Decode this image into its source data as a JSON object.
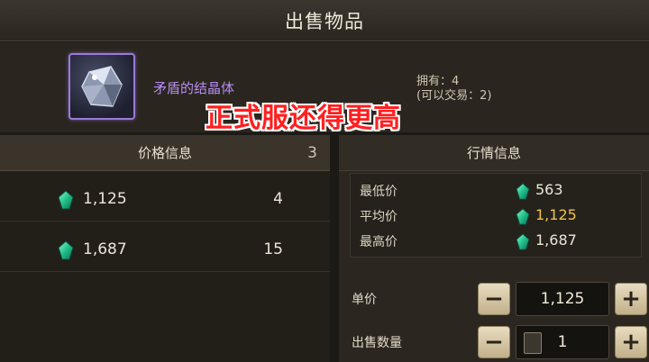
{
  "header": {
    "title": "出售物品"
  },
  "item": {
    "icon": "crystal-icon",
    "name": "矛盾的结晶体",
    "owned": "拥有：4",
    "tradable": "(可以交易：2)"
  },
  "overlay": {
    "caption": "正式服还得更高"
  },
  "price_panel": {
    "title": "价格信息",
    "count": "3",
    "rows": [
      {
        "price": "1,125",
        "qty": "4"
      },
      {
        "price": "1,687",
        "qty": "15"
      }
    ]
  },
  "market_panel": {
    "title": "行情信息",
    "stats": [
      {
        "label": "最低价",
        "value": "563"
      },
      {
        "label": "平均价",
        "value": "1,125"
      },
      {
        "label": "最高价",
        "value": "1,687"
      }
    ],
    "unit_price_label": "单价",
    "unit_price_value": "1,125",
    "quantity_label": "出售数量",
    "quantity_value": "1",
    "minus": "−",
    "plus": "+"
  },
  "colors": {
    "item_name": "#b78cf0",
    "average": "#f0c24a",
    "caption": "#ff2020",
    "currency": "#2fcf9a"
  }
}
